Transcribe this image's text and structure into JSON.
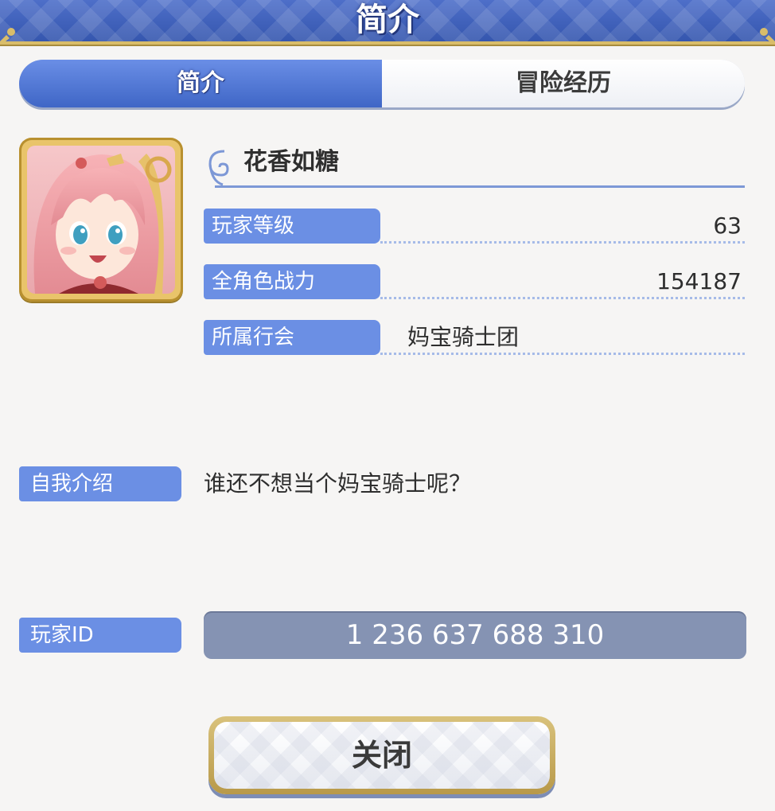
{
  "header": {
    "title": "简介"
  },
  "tabs": [
    {
      "label": "简介",
      "active": true
    },
    {
      "label": "冒险经历",
      "active": false
    }
  ],
  "profile": {
    "name": "花香如糖",
    "stats": [
      {
        "label": "玩家等级",
        "value": "63"
      },
      {
        "label": "全角色战力",
        "value": "154187"
      },
      {
        "label": "所属行会",
        "value": "妈宝骑士团"
      }
    ]
  },
  "intro": {
    "label": "自我介绍",
    "text": "谁还不想当个妈宝骑士呢？"
  },
  "player_id": {
    "label": "玩家ID",
    "value": "1 236 637 688 310"
  },
  "close_button": {
    "label": "关闭"
  },
  "colors": {
    "accent": "#6b8fe4",
    "header": "#3f62bd",
    "gold": "#d9bd6a",
    "id_box": "#8593b3"
  }
}
